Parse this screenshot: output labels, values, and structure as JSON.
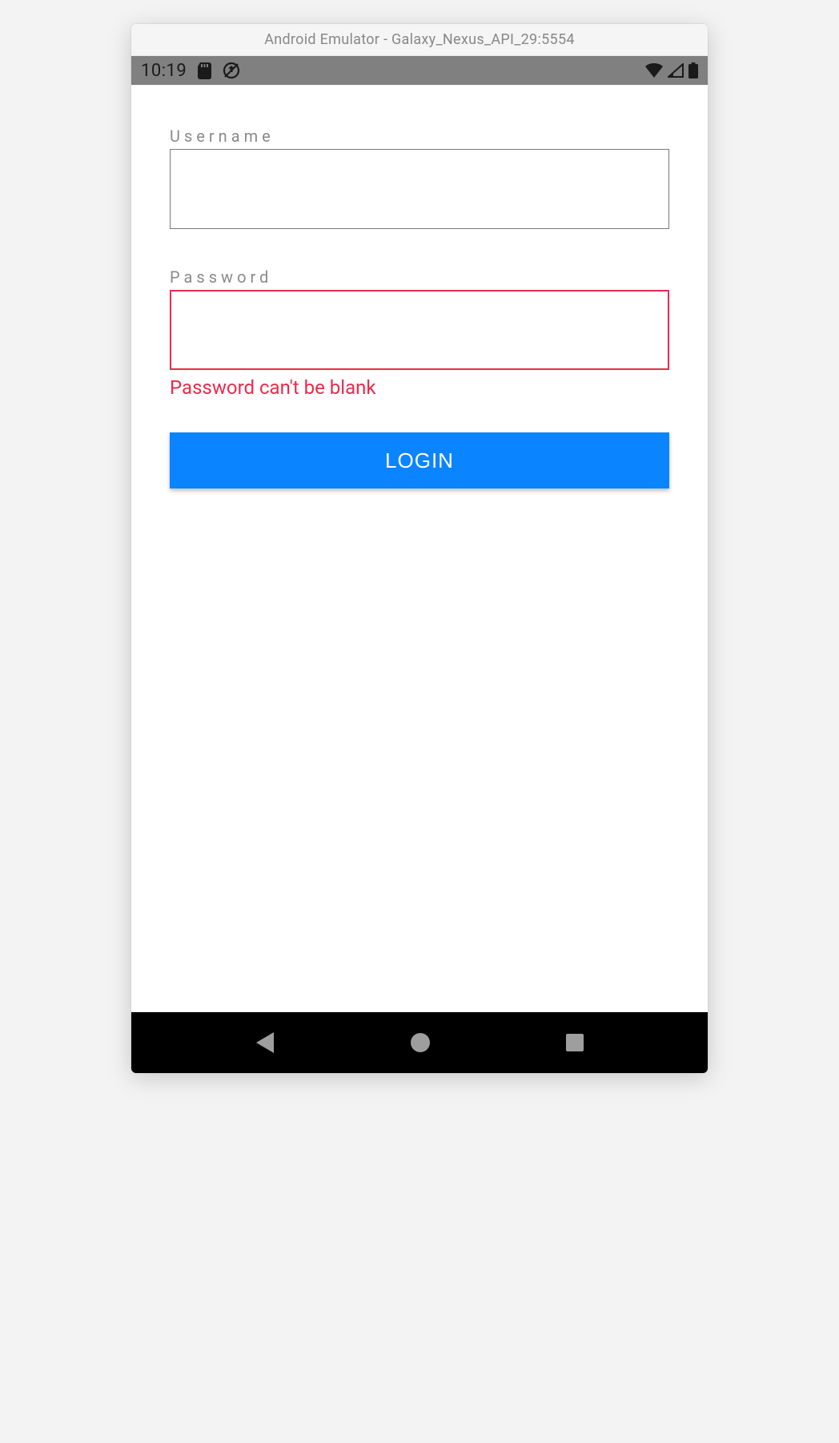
{
  "window": {
    "title": "Android Emulator - Galaxy_Nexus_API_29:5554"
  },
  "status": {
    "time": "10:19"
  },
  "form": {
    "username": {
      "label": "Username",
      "value": ""
    },
    "password": {
      "label": "Password",
      "value": "",
      "error": "Password can't be blank"
    },
    "login_label": "LOGIN"
  }
}
